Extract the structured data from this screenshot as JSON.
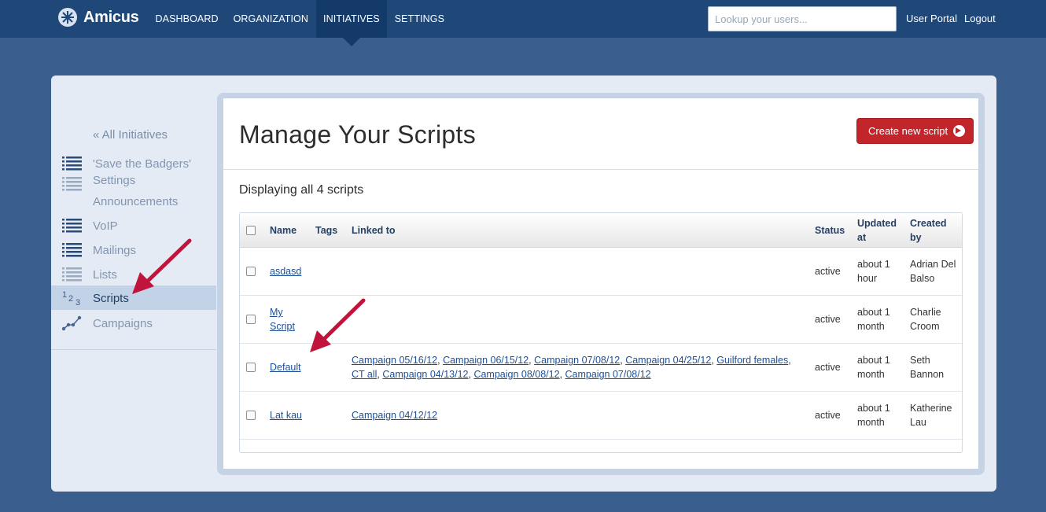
{
  "app": {
    "name": "Amicus"
  },
  "nav": {
    "items": [
      {
        "label": "DASHBOARD",
        "active": false
      },
      {
        "label": "ORGANIZATION",
        "active": false
      },
      {
        "label": "INITIATIVES",
        "active": true
      },
      {
        "label": "SETTINGS",
        "active": false
      }
    ]
  },
  "search": {
    "placeholder": "Lookup your users...",
    "value": ""
  },
  "header_links": {
    "user_portal": "User Portal",
    "logout": "Logout"
  },
  "sidebar": {
    "back_link": "« All Initiatives",
    "items": [
      {
        "label": "'Save the Badgers'\nSettings",
        "icon": "list-icon",
        "active": false
      },
      {
        "label": "Announcements",
        "icon": "list-icon",
        "active": false
      },
      {
        "label": "VoIP",
        "icon": "list-icon",
        "active": false
      },
      {
        "label": "Mailings",
        "icon": "list-icon",
        "active": false
      },
      {
        "label": "Lists",
        "icon": "list-icon",
        "active": false
      },
      {
        "label": "Scripts",
        "icon": "numbers-icon",
        "active": true
      },
      {
        "label": "Campaigns",
        "icon": "graph-icon",
        "active": false
      }
    ],
    "icon_numbers": {
      "one": "1",
      "two": "2",
      "three": "3"
    }
  },
  "main": {
    "title": "Manage Your Scripts",
    "create_button": "Create new script",
    "count_text": "Displaying all 4 scripts"
  },
  "table": {
    "headers": {
      "name": "Name",
      "tags": "Tags",
      "linked_to": "Linked to",
      "status": "Status",
      "updated_at": "Updated at",
      "created_by": "Created by"
    },
    "rows": [
      {
        "name": "asdasd",
        "tags": "",
        "linked": [],
        "status": "active",
        "updated": "about 1 hour",
        "created_by": "Adrian Del Balso"
      },
      {
        "name": "My Script",
        "tags": "",
        "linked": [],
        "status": "active",
        "updated": "about 1 month",
        "created_by": "Charlie Croom"
      },
      {
        "name": "Default",
        "tags": "",
        "linked": [
          "Campaign 05/16/12",
          "Campaign 06/15/12",
          "Campaign 07/08/12",
          "Campaign 04/25/12",
          "Guilford females",
          "CT all",
          "Campaign 04/13/12",
          "Campaign 08/08/12",
          "Campaign 07/08/12"
        ],
        "status": "active",
        "updated": "about 1 month",
        "created_by": "Seth Bannon"
      },
      {
        "name": "Lat kau",
        "tags": "",
        "linked": [
          "Campaign 04/12/12"
        ],
        "status": "active",
        "updated": "about 1 month",
        "created_by": "Katherine Lau"
      }
    ]
  },
  "colors": {
    "topbar": "#1f4778",
    "background": "#3a5f8e",
    "accent_button": "#c2262b",
    "link": "#1b4f98",
    "annotation_arrow": "#c0143c"
  }
}
